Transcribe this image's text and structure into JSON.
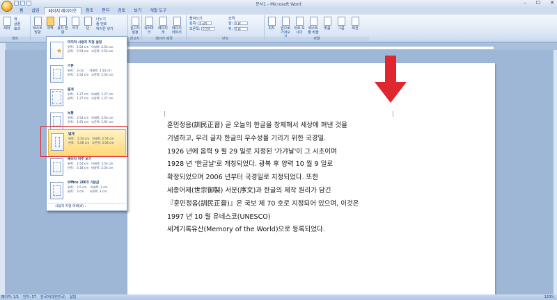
{
  "window": {
    "title": "문서1 - Microsoft Word",
    "min": "–",
    "max": "☐",
    "close": "✕"
  },
  "tabs": [
    "홈",
    "삽입",
    "페이지 레이아웃",
    "참조",
    "편지",
    "검토",
    "보기",
    "개발 도구"
  ],
  "active_tab": "페이지 레이아웃",
  "ribbon": {
    "theme_group": {
      "label": "테마",
      "items": [
        "테마",
        "색",
        "글꼴",
        "효과"
      ]
    },
    "page_setup": {
      "label": "페이지 설정",
      "buttons": [
        "텍스트 방향",
        "여백",
        "용지 방향",
        "크기",
        "단"
      ],
      "small": [
        "나누기",
        "줄 번호",
        "하이픈 넣기"
      ]
    },
    "background": {
      "label": "페이지 배경",
      "buttons": [
        "워터마크",
        "페이지 색",
        "페이지 테두리"
      ]
    },
    "original": {
      "label": "원고지",
      "button": "원고지 설정"
    },
    "paragraph": {
      "label": "단락",
      "indent_title": "들여쓰기",
      "spacing_title": "간격",
      "left": "왼쪽:",
      "right": "오른쪽:",
      "before": "앞:",
      "after": "뒤:",
      "left_val": "0 글자",
      "right_val": "0 글자",
      "before_val": "0 pt",
      "after_val": "0 pt"
    },
    "arrange": {
      "label": "정렬",
      "buttons": [
        "위치",
        "앞으로 가져오기",
        "뒤로 보내기",
        "텍스트 줄 바꿈",
        "맞춤",
        "그룹",
        "회전"
      ]
    }
  },
  "margins_menu": {
    "items": [
      {
        "name": "마지막 사용자 지정 설정",
        "vals": "위쪽:   2.54 cm   아래쪽: 2.54 cm\n왼쪽:   2.54 cm   오른쪽: 2.54 cm",
        "icon": "star-icon"
      },
      {
        "name": "기본",
        "vals": "위쪽:   3 cm      아래쪽: 2.54 cm\n왼쪽:   2.54 cm   오른쪽: 2.54 cm"
      },
      {
        "name": "좁게",
        "vals": "위쪽:   1.27 cm   아래쪽: 1.27 cm\n왼쪽:   1.27 cm   오른쪽: 1.27 cm"
      },
      {
        "name": "보통",
        "vals": "위쪽:   2.54 cm   아래쪽: 2.54 cm\n왼쪽:   1.91 cm   오른쪽: 1.91 cm"
      },
      {
        "name": "넓게",
        "vals": "위쪽:   2.54 cm   아래쪽: 2.54 cm\n왼쪽:   5.08 cm   오른쪽: 5.08 cm",
        "highlighted": true
      },
      {
        "name": "페이지 마주 보기",
        "vals": "위쪽:   2.54 cm   아래쪽: 2.54 cm\n안쪽:   3.18 cm   바깥쪽: 2.54 cm"
      },
      {
        "name": "Office 2003 기본값",
        "vals": "위쪽:   2.5 cm    아래쪽: 3 cm\n왼쪽:   3 cm      오른쪽: 3 cm"
      }
    ],
    "footer": "사용자 지정 여백(A)..."
  },
  "document": {
    "lines": [
      "훈민정음(訓民正音) 곧 오늘의 한글을 창제해서 세상에 펴낸 것을",
      "기념하고, 우리 글자 한글의 우수성을 기리기 위한 국경일.",
      "1926 년에 음력 9 월 29 일로 지정된 '가갸날'이 그 시초이며",
      "1928 년 '한글날'로 개칭되었다. 광복 후 양력 10 월 9 일로",
      "확정되었으며 2006 년부터 국경일로 지정되었다. 또한",
      "세종어제(世宗御製) 서문(序文)과 한글의 제작 원리가 담긴",
      "『훈민정음(訓民正音)』은 국보 제 70 호로 지정되어 있으며, 이것은",
      "1997 년 10 월 유네스코(UNESCO)",
      "세계기록유산(Memory of the World)으로 등록되었다."
    ]
  },
  "status": {
    "page": "페이지: 1/1",
    "words": "단어: 57",
    "lang": "한국어(대한민국)",
    "mode": "삽입",
    "zoom": "120%"
  },
  "colors": {
    "arrow": "#e0262e",
    "highlight": "#ffd879"
  }
}
